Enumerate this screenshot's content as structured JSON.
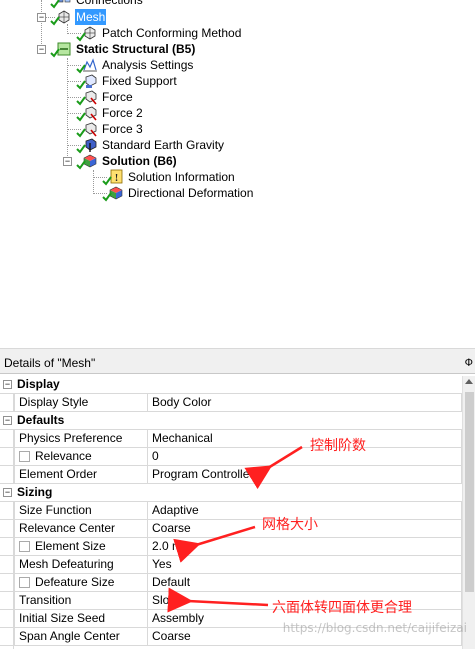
{
  "tree": {
    "items": [
      {
        "label": "Connections",
        "icon": "connections-icon"
      },
      {
        "label": "Mesh",
        "icon": "mesh-icon",
        "selected": true
      },
      {
        "label": "Patch Conforming Method",
        "icon": "mesh-method-icon"
      },
      {
        "label": "Static Structural (B5)",
        "icon": "static-structural-icon",
        "bold": true
      },
      {
        "label": "Analysis Settings",
        "icon": "analysis-settings-icon"
      },
      {
        "label": "Fixed Support",
        "icon": "fixed-support-icon"
      },
      {
        "label": "Force",
        "icon": "force-icon"
      },
      {
        "label": "Force 2",
        "icon": "force-icon"
      },
      {
        "label": "Force 3",
        "icon": "force-icon"
      },
      {
        "label": "Standard Earth Gravity",
        "icon": "gravity-icon"
      },
      {
        "label": "Solution (B6)",
        "icon": "solution-icon",
        "bold": true
      },
      {
        "label": "Solution Information",
        "icon": "solution-information-icon"
      },
      {
        "label": "Directional Deformation",
        "icon": "directional-deformation-icon"
      }
    ]
  },
  "details": {
    "title": "Details of \"Mesh\"",
    "pin": "Ф",
    "groups": [
      {
        "name": "Display",
        "rows": [
          {
            "label": "Display Style",
            "value": "Body Color"
          }
        ]
      },
      {
        "name": "Defaults",
        "rows": [
          {
            "label": "Physics Preference",
            "value": "Mechanical"
          },
          {
            "label": "Relevance",
            "value": "0"
          },
          {
            "label": "Element Order",
            "value": "Program Controlled"
          }
        ]
      },
      {
        "name": "Sizing",
        "rows": [
          {
            "label": "Size Function",
            "value": "Adaptive"
          },
          {
            "label": "Relevance Center",
            "value": "Coarse"
          },
          {
            "label": "Element Size",
            "value": "2.0 mm"
          },
          {
            "label": "Mesh Defeaturing",
            "value": "Yes"
          },
          {
            "label": "Defeature Size",
            "value": "Default"
          },
          {
            "label": "Transition",
            "value": "Slow"
          },
          {
            "label": "Initial Size Seed",
            "value": "Assembly"
          },
          {
            "label": "Span Angle Center",
            "value": "Coarse"
          }
        ]
      }
    ]
  },
  "annotations": {
    "order": "控制阶数",
    "size": "网格大小",
    "transition": "六面体转四面体更合理"
  },
  "watermark": "https://blog.csdn.net/caijifeizai",
  "colors": {
    "selection": "#3399ff",
    "check": "#1a9c1a",
    "annotation": "#ff2020"
  }
}
